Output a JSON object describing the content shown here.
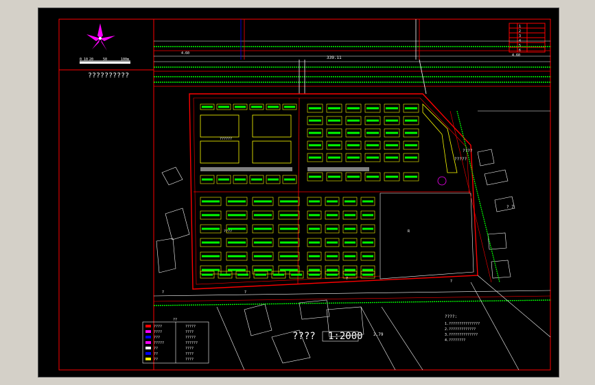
{
  "drawing": {
    "north_arrow_title": "??????????",
    "scale_bar_labels": [
      "0",
      "10",
      "20",
      "50",
      "100m"
    ],
    "scale_title": "????",
    "scale_ratio": "1:2000",
    "area_labels": {
      "block_a": "??????",
      "block_b": "????",
      "block_c": "R"
    },
    "road_labels": [
      "339.11",
      "4.60",
      "4.60",
      "7",
      "7",
      "7",
      "7",
      "2.79"
    ],
    "side_labels": [
      "????",
      "?????",
      "? 7"
    ],
    "notes_title": "????:",
    "notes_lines": [
      "1.???????????????",
      "2.?????????????",
      "3.??????????????",
      "4.????????"
    ],
    "legend_title": "??",
    "legend_rows": [
      {
        "left": "????",
        "right": "?????"
      },
      {
        "left": "????",
        "right": "????"
      },
      {
        "left": "???",
        "right": "?????"
      },
      {
        "left": "?????",
        "right": "??????"
      },
      {
        "left": "??",
        "right": "????"
      },
      {
        "left": "??",
        "right": "????"
      },
      {
        "left": "??",
        "right": "????"
      }
    ],
    "title_block_rows": [
      "1",
      "2",
      "3",
      "4",
      "5",
      "6"
    ]
  },
  "colors": {
    "background": "#000000",
    "frame": "#ff0000",
    "road": "#ff0000",
    "building": "#ffff00",
    "green": "#00ff00",
    "white": "#ffffff",
    "blue": "#0000ff",
    "magenta": "#ff00ff",
    "grey": "#808080"
  }
}
